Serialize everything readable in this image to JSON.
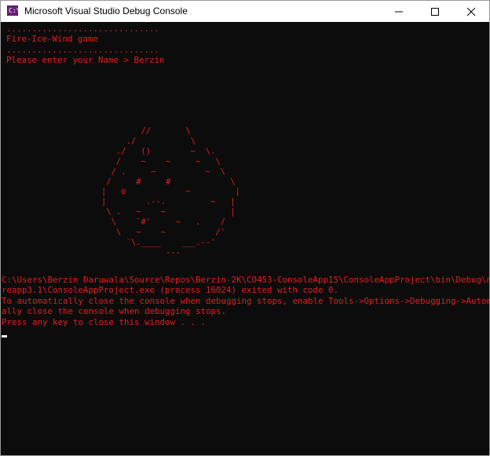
{
  "window": {
    "title": "Microsoft Visual Studio Debug Console",
    "icon": "visual-studio-console-icon",
    "icon_label": "C:\\"
  },
  "colors": {
    "console_background": "#0c0c0c",
    "console_text": "#e61e1e",
    "titlebar": "#ffffff",
    "cursor": "#f0f0f0"
  },
  "console": {
    "game_lines": [
      "..............................",
      "Fire-Ice-Wind game",
      "..............................",
      "Please enter your Name > Berzin"
    ],
    "art_lines": [
      "           //       \\",
      "        ./           \\",
      "      ./   ()        ~  \\.",
      "      /    ~    ~     ~   \\",
      "     / .     ~          ~  \\",
      "    /     #     #            \\",
      "   |   o            ~         |",
      "   |        .--.         ~   |",
      "    \\ .   ~    ~             |",
      "     \\    `#'     ~   .    /",
      "      \\   ~    ~          /'",
      "        `\\.____    ___.--'",
      "                ---"
    ],
    "exit_lines": [
      "C:\\Users\\Berzin Daruwala\\Source\\Repos\\Berzin-2K\\CO453-ConsoleApp15\\ConsoleAppProject\\bin\\Debug\\netco",
      "reapp3.1\\ConsoleAppProject.exe (process 16024) exited with code 0.",
      "To automatically close the console when debugging stops, enable Tools->Options->Debugging->Automatic",
      "ally close the console when debugging stops.",
      "Press any key to close this window . . ."
    ]
  }
}
